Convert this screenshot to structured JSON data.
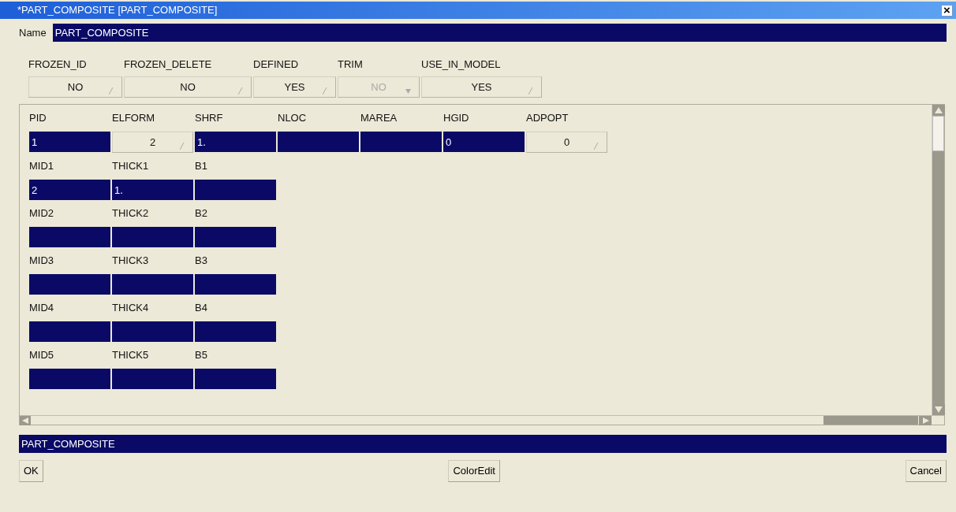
{
  "window": {
    "title": "*PART_COMPOSITE [PART_COMPOSITE]",
    "close": "×"
  },
  "name": {
    "label": "Name",
    "value": "PART_COMPOSITE"
  },
  "flags": [
    {
      "label": "FROZEN_ID",
      "value": "NO",
      "kind": "toggle",
      "disabled": false
    },
    {
      "label": "FROZEN_DELETE",
      "value": "NO",
      "kind": "toggle",
      "disabled": false
    },
    {
      "label": "DEFINED",
      "value": "YES",
      "kind": "toggle",
      "disabled": false
    },
    {
      "label": "TRIM",
      "value": "NO",
      "kind": "menu",
      "disabled": true
    },
    {
      "label": "USE_IN_MODEL",
      "value": "YES",
      "kind": "toggle",
      "disabled": false
    }
  ],
  "groups": [
    {
      "labels": [
        "PID",
        "ELFORM",
        "SHRF",
        "NLOC",
        "MAREA",
        "HGID",
        "ADPOPT"
      ],
      "fields": [
        {
          "kind": "input",
          "value": "1"
        },
        {
          "kind": "toggle",
          "value": "2"
        },
        {
          "kind": "input",
          "value": "1."
        },
        {
          "kind": "input"
        },
        {
          "kind": "input"
        },
        {
          "kind": "input",
          "value": "0"
        },
        {
          "kind": "toggle",
          "value": "0"
        }
      ]
    },
    {
      "labels": [
        "MID1",
        "THICK1",
        "B1"
      ],
      "fields": [
        {
          "kind": "input",
          "value": "2"
        },
        {
          "kind": "input",
          "value": "1."
        },
        {
          "kind": "input"
        }
      ]
    },
    {
      "labels": [
        "MID2",
        "THICK2",
        "B2"
      ],
      "fields": [
        {
          "kind": "input"
        },
        {
          "kind": "input"
        },
        {
          "kind": "input"
        }
      ]
    },
    {
      "labels": [
        "MID3",
        "THICK3",
        "B3"
      ],
      "fields": [
        {
          "kind": "input"
        },
        {
          "kind": "input"
        },
        {
          "kind": "input"
        }
      ]
    },
    {
      "labels": [
        "MID4",
        "THICK4",
        "B4"
      ],
      "fields": [
        {
          "kind": "input"
        },
        {
          "kind": "input"
        },
        {
          "kind": "input"
        }
      ]
    },
    {
      "labels": [
        "MID5",
        "THICK5",
        "B5"
      ],
      "fields": [
        {
          "kind": "input"
        },
        {
          "kind": "input"
        },
        {
          "kind": "input"
        }
      ]
    }
  ],
  "status_bar": "PART_COMPOSITE",
  "buttons": [
    "OK",
    "ColorEdit",
    "Cancel"
  ]
}
